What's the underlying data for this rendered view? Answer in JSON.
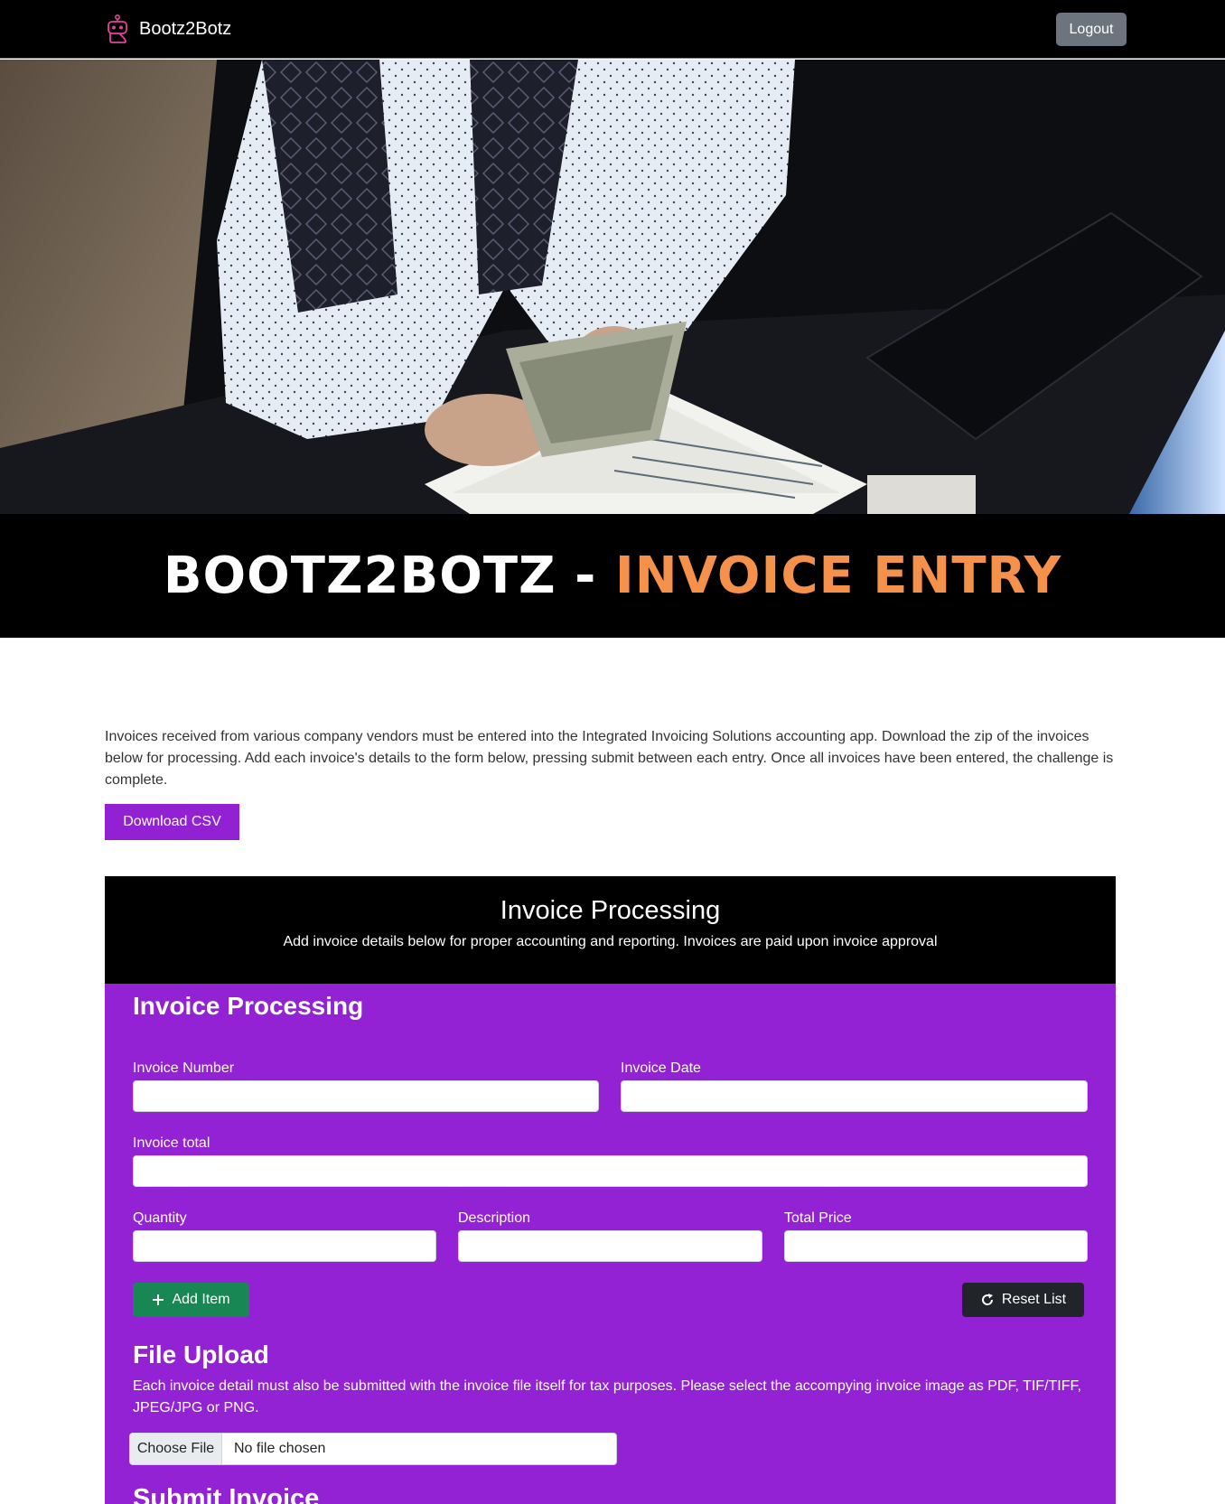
{
  "nav": {
    "brand": "Bootz2Botz",
    "logout_label": "Logout"
  },
  "hero": {
    "title_main": "BOOTZ2BOTZ - ",
    "title_accent": "INVOICE ENTRY"
  },
  "intro": {
    "text": "Invoices received from various company vendors must be entered into the Integrated Invoicing Solutions accounting app. Download the zip of the invoices below for processing. Add each invoice's details to the form below, pressing submit between each entry. Once all invoices have been entered, the challenge is complete.",
    "download_label": "Download CSV"
  },
  "card": {
    "title": "Invoice Processing",
    "subtitle": "Add invoice details below for proper accounting and reporting. Invoices are paid upon invoice approval"
  },
  "form": {
    "title": "Invoice Processing",
    "invoice_number_label": "Invoice Number",
    "invoice_date_label": "Invoice Date",
    "invoice_total_label": "Invoice total",
    "quantity_label": "Quantity",
    "description_label": "Description",
    "total_price_label": "Total Price",
    "add_item_label": "Add Item",
    "reset_list_label": "Reset List"
  },
  "upload": {
    "title": "File Upload",
    "description": "Each invoice detail must also be submitted with the invoice file itself for tax purposes. Please select the accompying invoice image as PDF, TIF/TIFF, JPEG/JPG or PNG.",
    "choose_label": "Choose File",
    "status": "No file chosen"
  },
  "submit": {
    "title": "Submit Invoice"
  },
  "colors": {
    "accent_orange": "#f5914a",
    "brand_purple": "#9322d4",
    "add_green": "#198754",
    "logo_pink": "#e0439a"
  }
}
